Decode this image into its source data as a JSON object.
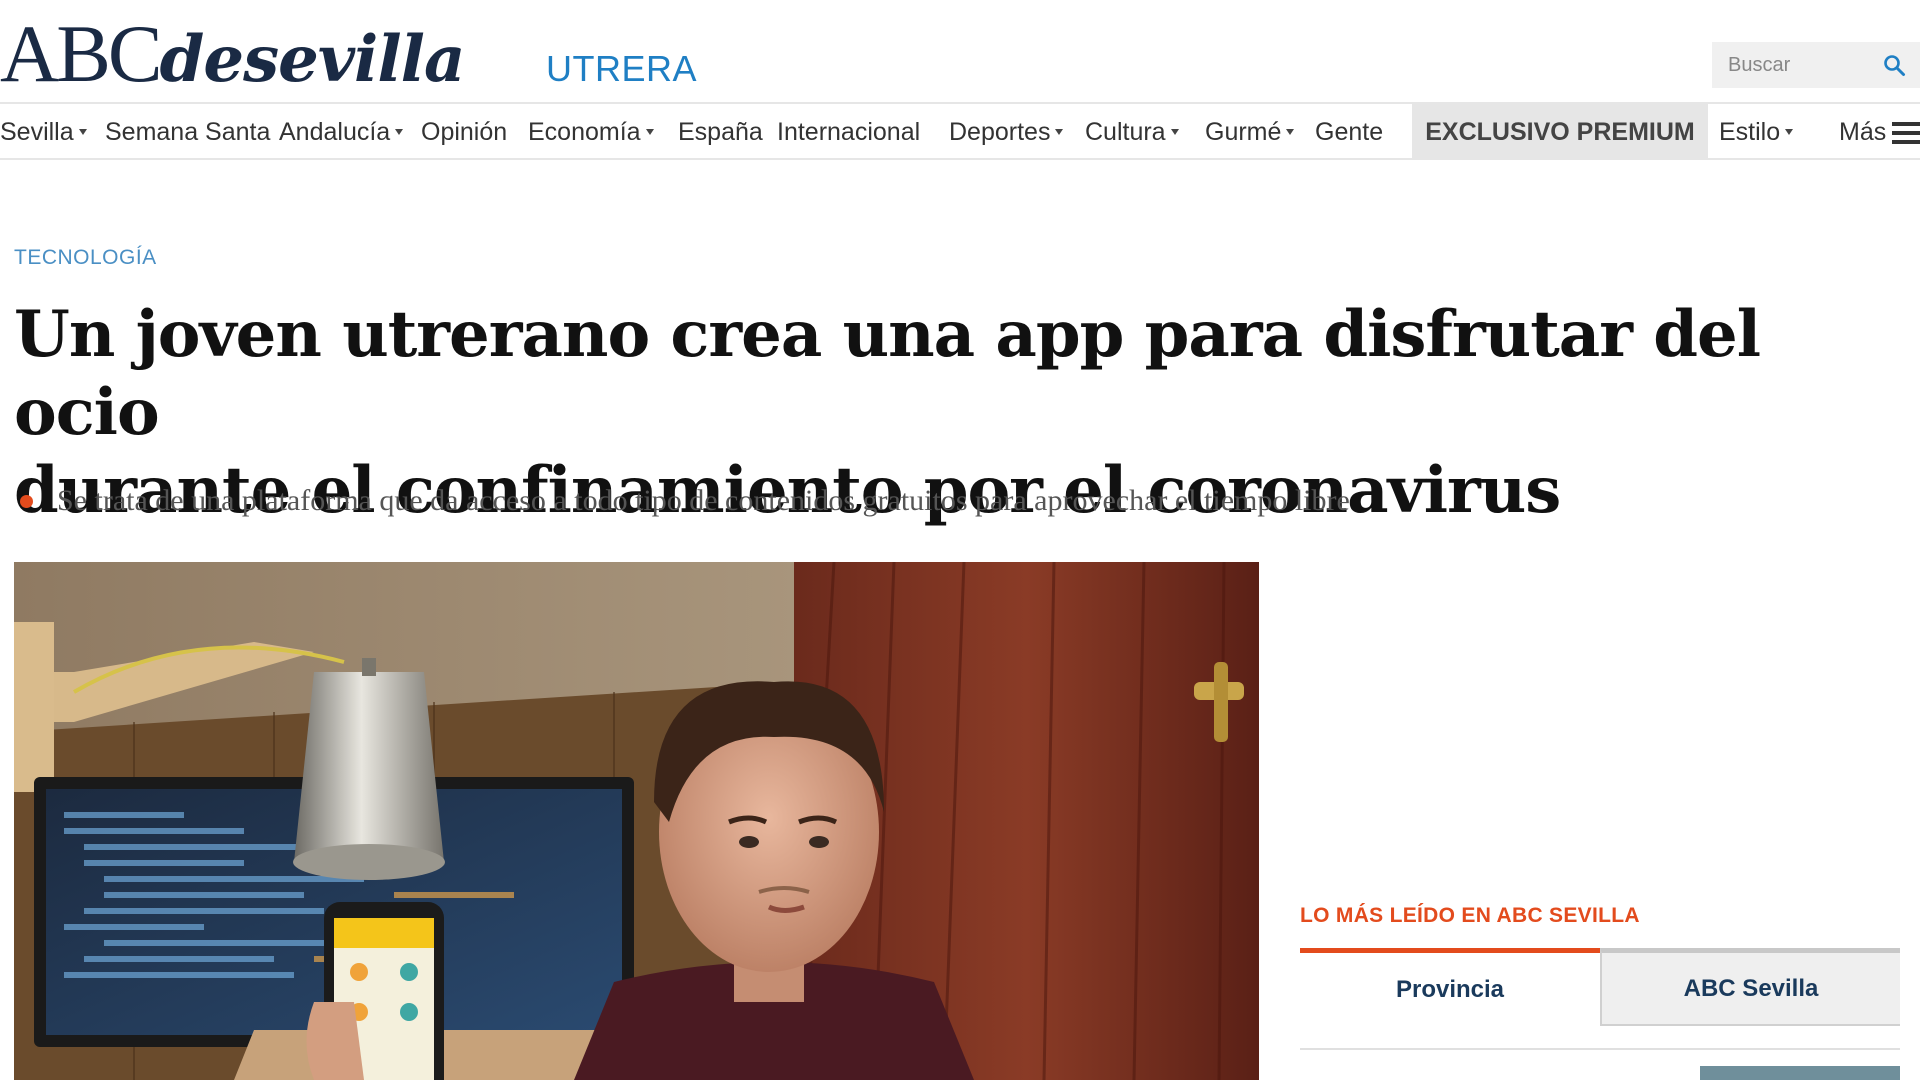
{
  "header": {
    "logo_abc": "ABC",
    "logo_de": "desevilla",
    "section": "UTRERA",
    "search_placeholder": "Buscar"
  },
  "nav": {
    "items": [
      {
        "label": "Sevilla",
        "dropdown": true
      },
      {
        "label": "Semana Santa",
        "dropdown": false
      },
      {
        "label": "Andalucía",
        "dropdown": true
      },
      {
        "label": "Opinión",
        "dropdown": false
      },
      {
        "label": "Economía",
        "dropdown": true
      },
      {
        "label": "España",
        "dropdown": false
      },
      {
        "label": "Internacional",
        "dropdown": false
      },
      {
        "label": "Deportes",
        "dropdown": true
      },
      {
        "label": "Cultura",
        "dropdown": true
      },
      {
        "label": "Gurmé",
        "dropdown": true
      },
      {
        "label": "Gente",
        "dropdown": false
      }
    ],
    "premium": "EXCLUSIVO PREMIUM",
    "estilo": "Estilo",
    "mas": "Más"
  },
  "article": {
    "kicker": "TECNOLOGÍA",
    "headline_line1": "Un joven utrerano crea una app para disfrutar del ocio",
    "headline_line2": "durante el confinamiento por el coronavirus",
    "subheadline": "Se trata de una plataforma que da acceso a todo tipo de contenidos gratuitos para aprovechar el tiempo libre"
  },
  "sidebar": {
    "most_read_title": "LO MÁS LEÍDO EN ABC SEVILLA",
    "tabs": [
      {
        "label": "Provincia",
        "active": true
      },
      {
        "label": "ABC Sevilla",
        "active": false
      }
    ]
  },
  "colors": {
    "accent_orange": "#e34b1d",
    "section_blue": "#1f7fc4",
    "logo_navy": "#1a2a44"
  }
}
